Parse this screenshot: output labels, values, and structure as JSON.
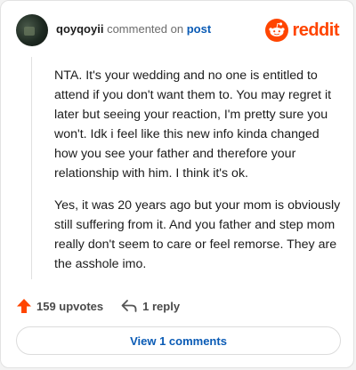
{
  "comment": {
    "username": "qoyqoyii",
    "action_text": "commented on",
    "post_link": "post",
    "paragraphs": [
      "NTA. It's your wedding and no one is entitled to attend if you don't want them to. You may regret it later but seeing your reaction, I'm pretty sure you won't. Idk i feel like this new info kinda changed how you see your father and therefore your relationship with him. I think it's ok.",
      "Yes, it was 20 years ago but your mom is obviously still suffering from it. And you father and step mom really don't seem to care or feel remorse. They are the asshole imo."
    ],
    "upvotes_label": "159 upvotes",
    "reply_label": "1 reply",
    "view_comments_label": "View 1 comments"
  },
  "brand": {
    "name": "reddit",
    "color": "#ff4500"
  },
  "icons": {
    "avatar": "user-avatar",
    "logo": "reddit-snoo-icon",
    "upvote": "upvote-arrow-icon",
    "reply": "reply-arrow-icon"
  },
  "colors": {
    "link": "#0a5bb5",
    "upvote": "#ff4500",
    "text": "#1c1c1c",
    "muted": "#4a4a4a"
  }
}
